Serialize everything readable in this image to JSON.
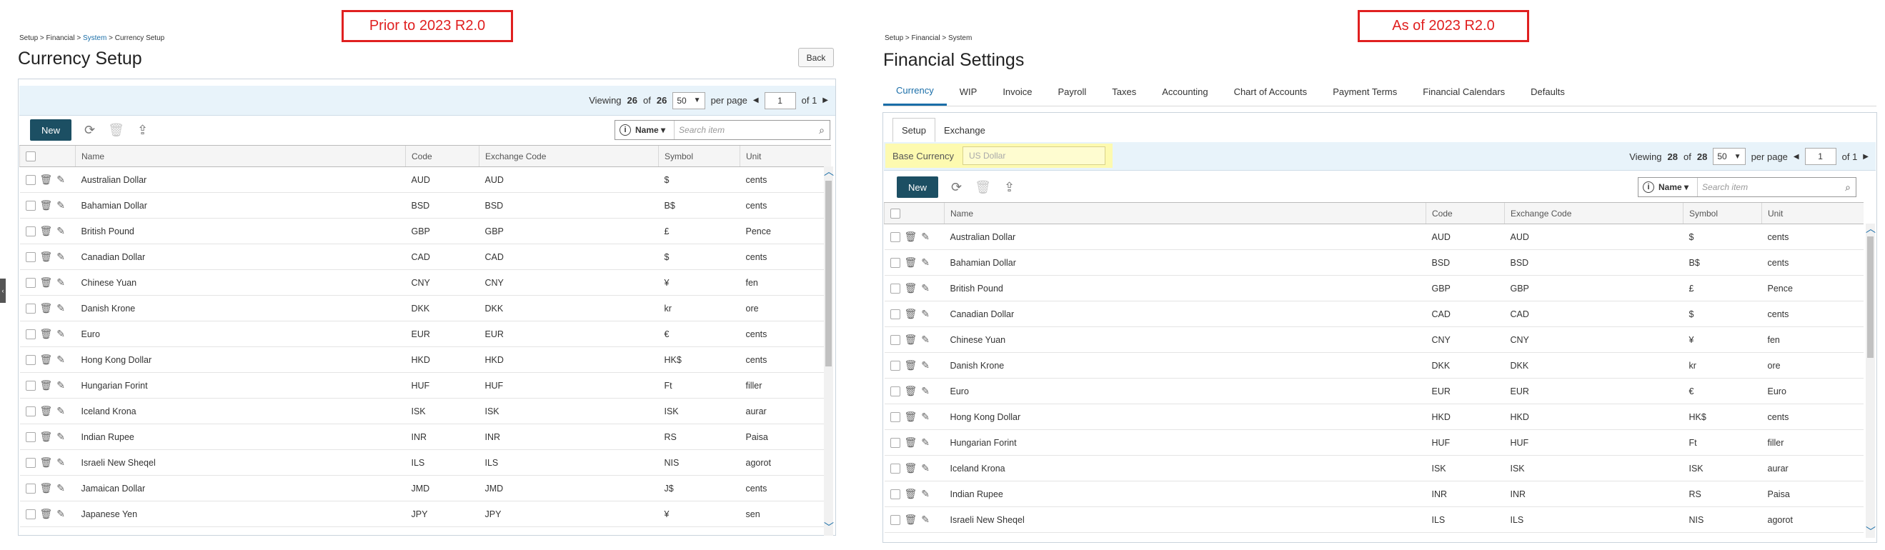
{
  "left": {
    "callout": "Prior to 2023 R2.0",
    "breadcrumb": {
      "a": "Setup",
      "b": "Financial",
      "c": "System",
      "d": "Currency Setup",
      "sep": ">"
    },
    "title": "Currency Setup",
    "back_label": "Back",
    "pager": {
      "viewing": "Viewing",
      "shown": "26",
      "of_word": "of",
      "total": "26",
      "per_page_value": "50",
      "per_page_label": "per page",
      "page": "1",
      "of_pages": "of 1"
    },
    "toolbar": {
      "new_label": "New",
      "refresh_icon": "refresh-icon",
      "delete_icon": "trash-icon",
      "export_icon": "export-icon"
    },
    "search": {
      "field": "Name",
      "placeholder": "Search item"
    },
    "columns": [
      "Name",
      "Code",
      "Exchange Code",
      "Symbol",
      "Unit"
    ],
    "rows": [
      [
        "Australian Dollar",
        "AUD",
        "AUD",
        "$",
        "cents"
      ],
      [
        "Bahamian Dollar",
        "BSD",
        "BSD",
        "B$",
        "cents"
      ],
      [
        "British Pound",
        "GBP",
        "GBP",
        "£",
        "Pence"
      ],
      [
        "Canadian Dollar",
        "CAD",
        "CAD",
        "$",
        "cents"
      ],
      [
        "Chinese Yuan",
        "CNY",
        "CNY",
        "¥",
        "fen"
      ],
      [
        "Danish Krone",
        "DKK",
        "DKK",
        "kr",
        "ore"
      ],
      [
        "Euro",
        "EUR",
        "EUR",
        "€",
        "cents"
      ],
      [
        "Hong Kong Dollar",
        "HKD",
        "HKD",
        "HK$",
        "cents"
      ],
      [
        "Hungarian Forint",
        "HUF",
        "HUF",
        "Ft",
        "filler"
      ],
      [
        "Iceland Krona",
        "ISK",
        "ISK",
        "ISK",
        "aurar"
      ],
      [
        "Indian Rupee",
        "INR",
        "INR",
        "RS",
        "Paisa"
      ],
      [
        "Israeli New Sheqel",
        "ILS",
        "ILS",
        "NIS",
        "agorot"
      ],
      [
        "Jamaican Dollar",
        "JMD",
        "JMD",
        "J$",
        "cents"
      ],
      [
        "Japanese Yen",
        "JPY",
        "JPY",
        "¥",
        "sen"
      ]
    ]
  },
  "right": {
    "callout": "As of 2023 R2.0",
    "breadcrumb": {
      "a": "Setup",
      "b": "Financial",
      "c": "System",
      "sep": ">"
    },
    "title": "Financial Settings",
    "tabs": [
      "Currency",
      "WIP",
      "Invoice",
      "Payroll",
      "Taxes",
      "Accounting",
      "Chart of Accounts",
      "Payment Terms",
      "Financial Calendars",
      "Defaults"
    ],
    "subtabs": [
      "Setup",
      "Exchange"
    ],
    "base_currency": {
      "label": "Base Currency",
      "placeholder": "US Dollar"
    },
    "pager": {
      "viewing": "Viewing",
      "shown": "28",
      "of_word": "of",
      "total": "28",
      "per_page_value": "50",
      "per_page_label": "per page",
      "page": "1",
      "of_pages": "of 1"
    },
    "toolbar": {
      "new_label": "New"
    },
    "search": {
      "field": "Name",
      "placeholder": "Search item"
    },
    "columns": [
      "Name",
      "Code",
      "Exchange Code",
      "Symbol",
      "Unit"
    ],
    "rows": [
      [
        "Australian Dollar",
        "AUD",
        "AUD",
        "$",
        "cents"
      ],
      [
        "Bahamian Dollar",
        "BSD",
        "BSD",
        "B$",
        "cents"
      ],
      [
        "British Pound",
        "GBP",
        "GBP",
        "£",
        "Pence"
      ],
      [
        "Canadian Dollar",
        "CAD",
        "CAD",
        "$",
        "cents"
      ],
      [
        "Chinese Yuan",
        "CNY",
        "CNY",
        "¥",
        "fen"
      ],
      [
        "Danish Krone",
        "DKK",
        "DKK",
        "kr",
        "ore"
      ],
      [
        "Euro",
        "EUR",
        "EUR",
        "€",
        "Euro"
      ],
      [
        "Hong Kong Dollar",
        "HKD",
        "HKD",
        "HK$",
        "cents"
      ],
      [
        "Hungarian Forint",
        "HUF",
        "HUF",
        "Ft",
        "filler"
      ],
      [
        "Iceland Krona",
        "ISK",
        "ISK",
        "ISK",
        "aurar"
      ],
      [
        "Indian Rupee",
        "INR",
        "INR",
        "RS",
        "Paisa"
      ],
      [
        "Israeli New Sheqel",
        "ILS",
        "ILS",
        "NIS",
        "agorot"
      ]
    ]
  },
  "colors": {
    "accent": "#1a6ea8",
    "callout": "#e02020",
    "new_button": "#1c4f63",
    "highlight": "#fdfab0",
    "pager_bar": "#e8f3fa"
  }
}
